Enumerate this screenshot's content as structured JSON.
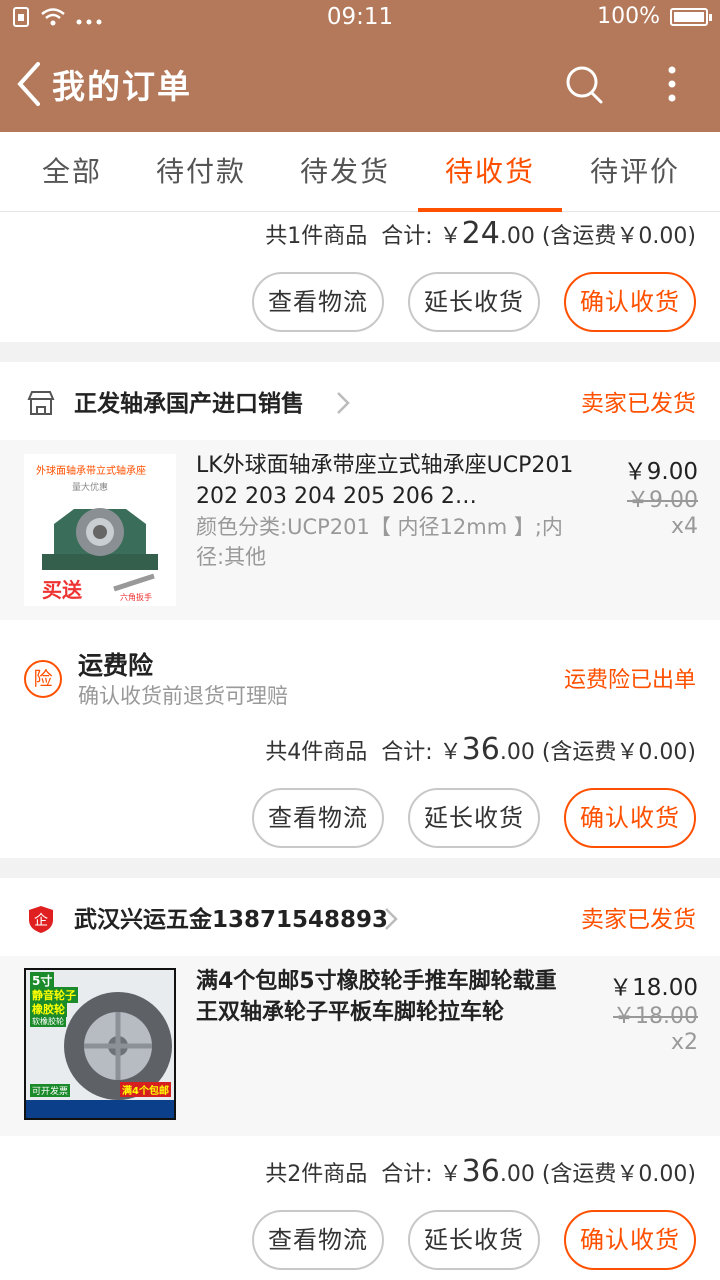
{
  "status_bar": {
    "time": "09:11",
    "battery": "100%",
    "battery_level": 1.0
  },
  "nav": {
    "title": "我的订单"
  },
  "tabs": [
    "全部",
    "待付款",
    "待发货",
    "待收货",
    "待评价"
  ],
  "active_tab": "待收货",
  "buttons": {
    "logistics": "查看物流",
    "extend": "延长收货",
    "confirm": "确认收货"
  },
  "orders": [
    {
      "summary_count": "共1件商品",
      "summary_label": "合计:",
      "summary_currency": "￥",
      "summary_int": "24",
      "summary_dec": ".00",
      "summary_shipping": "(含运费￥0.00)"
    },
    {
      "shop_name": "正发轴承国产进口销售",
      "status": "卖家已发货",
      "item": {
        "title": "LK外球面轴承带座立式轴承座UCP201 202 203 204 205 206 2…",
        "sku": "颜色分类:UCP201【 内径12mm 】;内径:其他",
        "price": "￥9.00",
        "original_price": "￥9.00",
        "qty": "x4",
        "thumb_text": "外球面轴承带立式轴承座",
        "thumb_sub": "量大优惠",
        "thumb_promo": "买送",
        "thumb_tool": "六角扳手"
      },
      "insurance": {
        "icon": "险",
        "title": "运费险",
        "subtitle": "确认收货前退货可理赔",
        "status": "运费险已出单"
      },
      "summary_count": "共4件商品",
      "summary_label": "合计:",
      "summary_currency": "￥",
      "summary_int": "36",
      "summary_dec": ".00",
      "summary_shipping": "(含运费￥0.00)"
    },
    {
      "shop_name": "武汉兴运五金13871548893",
      "status": "卖家已发货",
      "item": {
        "title": "满4个包邮5寸橡胶轮手推车脚轮载重王双轴承轮子平板车脚轮拉车轮",
        "price": "￥18.00",
        "original_price": "￥18.00",
        "qty": "x2",
        "thumb_size": "5寸",
        "thumb_line1": "静音轮子",
        "thumb_line2": "橡胶轮",
        "thumb_line3": "软橡胶轮",
        "thumb_invoice": "可开发票",
        "thumb_promo": "满4个包邮"
      },
      "summary_count": "共2件商品",
      "summary_label": "合计:",
      "summary_currency": "￥",
      "summary_int": "36",
      "summary_dec": ".00",
      "summary_shipping": "(含运费￥0.00)"
    }
  ],
  "colors": {
    "header": "#b3795a",
    "accent": "#ff5000"
  }
}
